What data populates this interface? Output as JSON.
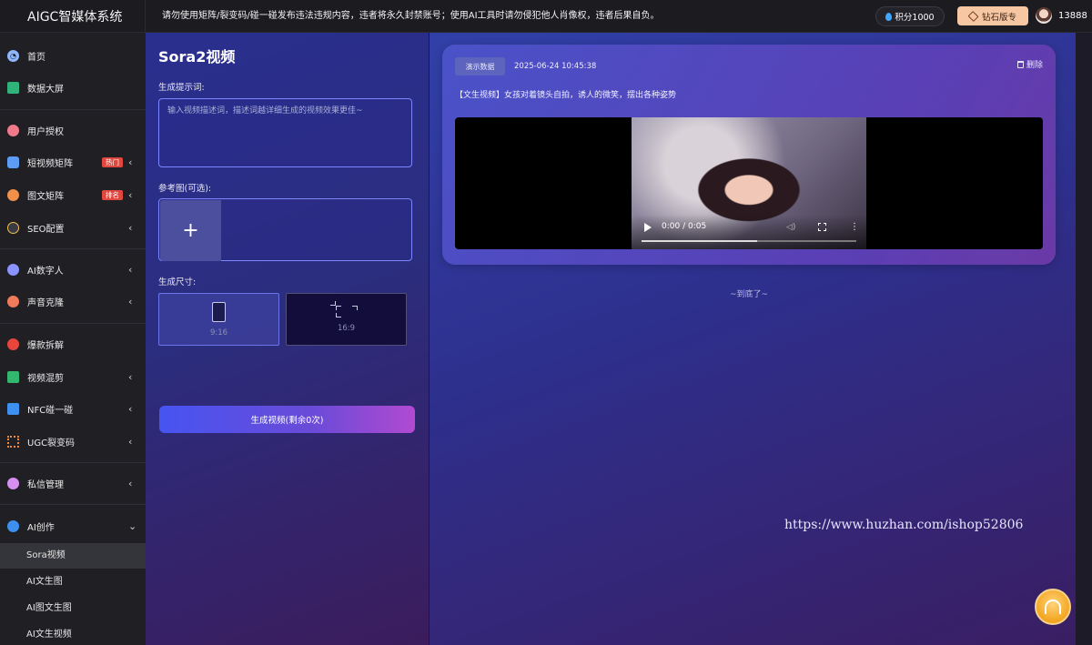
{
  "app": {
    "title": "AIGC智媒体系统"
  },
  "header": {
    "notice": "请勿使用矩阵/裂变码/碰一碰发布违法违规内容，违者将永久封禁账号；使用AI工具时请勿侵犯他人肖像权，违者后果自负。",
    "points": "积分1000",
    "vip": "钻石版专",
    "user": "13888"
  },
  "sidebar": {
    "items": [
      {
        "label": "首页"
      },
      {
        "label": "数据大屏"
      },
      {
        "label": "用户授权"
      },
      {
        "label": "短视频矩阵",
        "tag": "热门",
        "arrow": "‹"
      },
      {
        "label": "图文矩阵",
        "tag": "排名",
        "arrow": "‹"
      },
      {
        "label": "SEO配置",
        "arrow": "‹"
      },
      {
        "label": "AI数字人",
        "arrow": "‹"
      },
      {
        "label": "声音克隆",
        "arrow": "‹"
      },
      {
        "label": "爆款拆解"
      },
      {
        "label": "视频混剪",
        "arrow": "‹"
      },
      {
        "label": "NFC碰一碰",
        "arrow": "‹"
      },
      {
        "label": "UGC裂变码",
        "arrow": "‹"
      },
      {
        "label": "私信管理",
        "arrow": "‹"
      },
      {
        "label": "AI创作",
        "arrow": "⌄"
      }
    ],
    "subitems": [
      {
        "label": "Sora视频"
      },
      {
        "label": "AI文生图"
      },
      {
        "label": "AI图文生图"
      },
      {
        "label": "AI文生视频"
      }
    ]
  },
  "form": {
    "title": "Sora2视频",
    "prompt_label": "生成提示词:",
    "prompt_placeholder": "输入视频描述词，描述词越详细生成的视频效果更佳~",
    "ref_label": "参考图(可选):",
    "plus": "+",
    "size_label": "生成尺寸:",
    "sizes": [
      {
        "label": "9:16"
      },
      {
        "label": "16:9"
      }
    ],
    "generate_label": "生成视频(剩余0次)"
  },
  "result": {
    "badge": "演示数据",
    "time": "2025-06-24 10:45:38",
    "delete": "删除",
    "text": "【文生视频】女孩对着镜头自拍，诱人的微笑，摆出各种姿势",
    "video_time": "0:00 / 0:05",
    "video_progress": 0.54,
    "end_text": "~到底了~"
  },
  "watermark": "https://www.huzhan.com/ishop52806",
  "colors": {
    "accent": "#4754f1",
    "vip": "#f6c7a2",
    "tag": "#e0473e"
  }
}
